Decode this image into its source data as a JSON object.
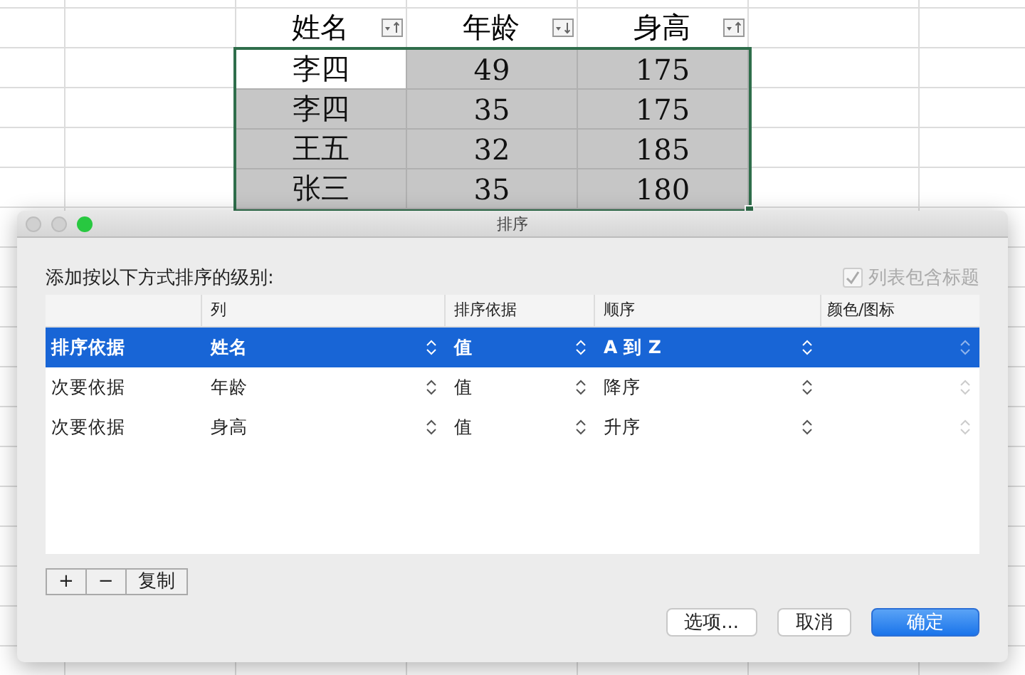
{
  "sheet": {
    "headers": [
      {
        "text": "姓名",
        "kind": "ascending"
      },
      {
        "text": "年龄",
        "kind": "descending"
      },
      {
        "text": "身高",
        "kind": "ascending"
      }
    ],
    "rows": [
      {
        "cells": [
          {
            "text": "李四",
            "active": true
          },
          {
            "text": "49",
            "active": false
          },
          {
            "text": "175",
            "active": false
          }
        ]
      },
      {
        "cells": [
          {
            "text": "李四",
            "active": false
          },
          {
            "text": "35",
            "active": false
          },
          {
            "text": "175",
            "active": false
          }
        ]
      },
      {
        "cells": [
          {
            "text": "王五",
            "active": false
          },
          {
            "text": "32",
            "active": false
          },
          {
            "text": "185",
            "active": false
          }
        ]
      },
      {
        "cells": [
          {
            "text": "张三",
            "active": false
          },
          {
            "text": "35",
            "active": false
          },
          {
            "text": "180",
            "active": false
          }
        ]
      }
    ]
  },
  "dialog": {
    "title": "排序",
    "prompt": "添加按以下方式排序的级别:",
    "header_checkbox": {
      "label": "列表包含标题",
      "checked": true,
      "disabled": true
    },
    "columns": [
      "列",
      "排序依据",
      "顺序",
      "颜色/图标"
    ],
    "levels": [
      {
        "label": "排序依据",
        "column": "姓名",
        "basis": "值",
        "order": "A 到 Z",
        "selected": true
      },
      {
        "label": "次要依据",
        "column": "年龄",
        "basis": "值",
        "order": "降序",
        "selected": false
      },
      {
        "label": "次要依据",
        "column": "身高",
        "basis": "值",
        "order": "升序",
        "selected": false
      }
    ],
    "tools": [
      "+",
      "−",
      "复制"
    ],
    "buttons": [
      {
        "label": "选项...",
        "primary": false
      },
      {
        "label": "取消",
        "primary": false
      },
      {
        "label": "确定",
        "primary": true
      }
    ]
  }
}
